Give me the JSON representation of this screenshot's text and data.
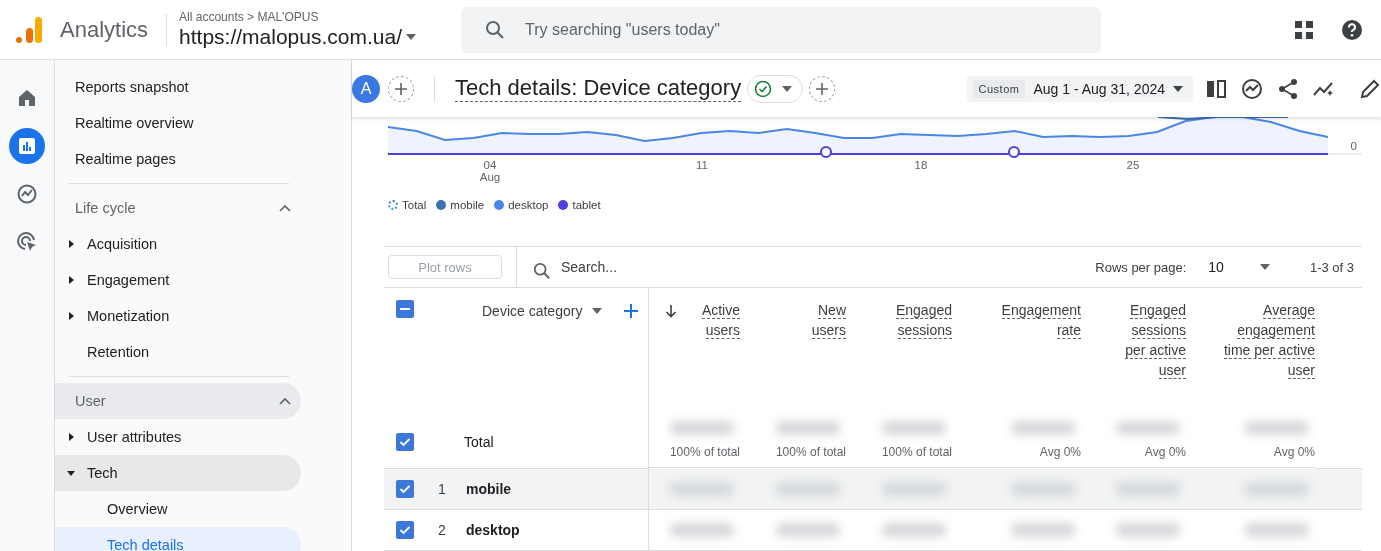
{
  "header": {
    "product": "Analytics",
    "breadcrumb": "All accounts > MAL'OPUS",
    "property": "https://malopus.com.ua/",
    "search": {
      "placeholder": "Try searching \"users today\""
    }
  },
  "rail": [
    {
      "kind": "home",
      "selected": false
    },
    {
      "kind": "reports",
      "selected": true
    },
    {
      "kind": "explore",
      "selected": false
    },
    {
      "kind": "advertising",
      "selected": false
    }
  ],
  "nav": [
    {
      "kind": "link",
      "label": "Reports snapshot",
      "selected": false
    },
    {
      "kind": "link",
      "label": "Realtime overview",
      "selected": false
    },
    {
      "kind": "link",
      "label": "Realtime pages",
      "selected": false
    },
    {
      "kind": "section",
      "label": "Life cycle",
      "expanded": true,
      "hover": false,
      "children": [
        {
          "label": "Acquisition",
          "expandable": true,
          "expanded": false,
          "selected": false
        },
        {
          "label": "Engagement",
          "expandable": true,
          "expanded": false,
          "selected": false
        },
        {
          "label": "Monetization",
          "expandable": true,
          "expanded": false,
          "selected": false
        },
        {
          "label": "Retention",
          "expandable": false,
          "expanded": false,
          "selected": false
        }
      ]
    },
    {
      "kind": "section",
      "label": "User",
      "expanded": true,
      "hover": true,
      "children": [
        {
          "label": "User attributes",
          "expandable": true,
          "expanded": false,
          "selected": false
        },
        {
          "label": "Tech",
          "expandable": true,
          "expanded": true,
          "selected": false,
          "children": [
            {
              "label": "Overview",
              "selected": false
            },
            {
              "label": "Tech details",
              "selected": true
            }
          ]
        }
      ]
    }
  ],
  "toolbar": {
    "avatar": "A",
    "title": "Tech details: Device category",
    "date_badge": "Custom",
    "date_range": "Aug 1 - Aug 31, 2024"
  },
  "chart": {
    "y_label": "0",
    "x_labels": [
      {
        "day": "04",
        "month": "Aug"
      },
      {
        "day": "11"
      },
      {
        "day": "18"
      },
      {
        "day": "25"
      }
    ],
    "legend": [
      {
        "kind": "total",
        "label": "Total",
        "color": "#4285f4"
      },
      {
        "kind": "series",
        "label": "mobile",
        "color": "#3b6fb6"
      },
      {
        "kind": "series",
        "label": "desktop",
        "color": "#4a86e8"
      },
      {
        "kind": "series",
        "label": "tablet",
        "color": "#4f3fe0"
      }
    ]
  },
  "table": {
    "plot_button": {
      "label": "Plot rows",
      "disabled": true
    },
    "search": {
      "placeholder": "Search..."
    },
    "rows_per_page_label": "Rows per page:",
    "rows_per_page": "10",
    "pagination": "1-3 of 3",
    "select_all": {
      "indeterminate": true
    },
    "dimension": "Device category",
    "columns": [
      {
        "label": "Active users",
        "sorted": true,
        "total_note": "100% of total"
      },
      {
        "label": "New users",
        "sorted": false,
        "total_note": "100% of total"
      },
      {
        "label": "Engaged sessions",
        "sorted": false,
        "total_note": "100% of total"
      },
      {
        "label": "Engagement rate",
        "sorted": false,
        "total_note": "Avg 0%"
      },
      {
        "label": "Engaged sessions per active user",
        "sorted": false,
        "total_note": "Avg 0%"
      },
      {
        "label": "Average engagement time per active user",
        "sorted": false,
        "total_note": "Avg 0%"
      }
    ],
    "total": {
      "label": "Total",
      "checked": true
    },
    "rows": [
      {
        "index": "1",
        "label": "mobile",
        "checked": true,
        "highlighted": true
      },
      {
        "index": "2",
        "label": "desktop",
        "checked": true,
        "highlighted": false
      }
    ]
  }
}
